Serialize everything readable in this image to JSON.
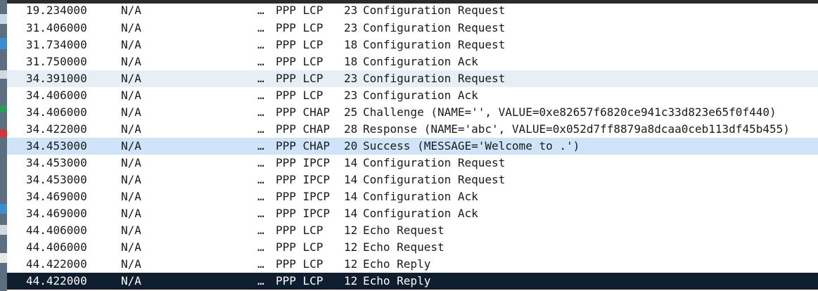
{
  "packets": [
    {
      "time": "19.234000",
      "dst": "N/A",
      "ellipsis": "…",
      "protocol": "PPP LCP",
      "length": "23",
      "info": "Configuration Request"
    },
    {
      "time": "31.406000",
      "dst": "N/A",
      "ellipsis": "…",
      "protocol": "PPP LCP",
      "length": "23",
      "info": "Configuration Request"
    },
    {
      "time": "31.734000",
      "dst": "N/A",
      "ellipsis": "…",
      "protocol": "PPP LCP",
      "length": "18",
      "info": "Configuration Request"
    },
    {
      "time": "31.750000",
      "dst": "N/A",
      "ellipsis": "…",
      "protocol": "PPP LCP",
      "length": "18",
      "info": "Configuration Ack"
    },
    {
      "time": "34.391000",
      "dst": "N/A",
      "ellipsis": "…",
      "protocol": "PPP LCP",
      "length": "23",
      "info": "Configuration Request"
    },
    {
      "time": "34.406000",
      "dst": "N/A",
      "ellipsis": "…",
      "protocol": "PPP LCP",
      "length": "23",
      "info": "Configuration Ack"
    },
    {
      "time": "34.406000",
      "dst": "N/A",
      "ellipsis": "…",
      "protocol": "PPP CHAP",
      "length": "25",
      "info": "Challenge (NAME='', VALUE=0xe82657f6820ce941c33d823e65f0f440)"
    },
    {
      "time": "34.422000",
      "dst": "N/A",
      "ellipsis": "…",
      "protocol": "PPP CHAP",
      "length": "28",
      "info": "Response (NAME='abc', VALUE=0x052d7ff8879a8dcaa0ceb113df45b455)"
    },
    {
      "time": "34.453000",
      "dst": "N/A",
      "ellipsis": "…",
      "protocol": "PPP CHAP",
      "length": "20",
      "info": "Success (MESSAGE='Welcome to .')"
    },
    {
      "time": "34.453000",
      "dst": "N/A",
      "ellipsis": "…",
      "protocol": "PPP IPCP",
      "length": "14",
      "info": "Configuration Request"
    },
    {
      "time": "34.453000",
      "dst": "N/A",
      "ellipsis": "…",
      "protocol": "PPP IPCP",
      "length": "14",
      "info": "Configuration Request"
    },
    {
      "time": "34.469000",
      "dst": "N/A",
      "ellipsis": "…",
      "protocol": "PPP IPCP",
      "length": "14",
      "info": "Configuration Ack"
    },
    {
      "time": "34.469000",
      "dst": "N/A",
      "ellipsis": "…",
      "protocol": "PPP IPCP",
      "length": "14",
      "info": "Configuration Ack"
    },
    {
      "time": "44.406000",
      "dst": "N/A",
      "ellipsis": "…",
      "protocol": "PPP LCP",
      "length": "12",
      "info": "Echo Request"
    },
    {
      "time": "44.406000",
      "dst": "N/A",
      "ellipsis": "…",
      "protocol": "PPP LCP",
      "length": "12",
      "info": "Echo Request"
    },
    {
      "time": "44.422000",
      "dst": "N/A",
      "ellipsis": "…",
      "protocol": "PPP LCP",
      "length": "12",
      "info": "Echo Reply"
    },
    {
      "time": "44.422000",
      "dst": "N/A",
      "ellipsis": "…",
      "protocol": "PPP LCP",
      "length": "12",
      "info": "Echo Reply"
    }
  ],
  "row_states": {
    "striped": [
      4
    ],
    "marked": [
      8
    ],
    "selected": [
      16
    ]
  },
  "colors": {
    "stripe": "#e6eef6",
    "marked": "#cfe4f8",
    "selected_bg": "#0f1e2e",
    "selected_text": "#ffffff"
  }
}
